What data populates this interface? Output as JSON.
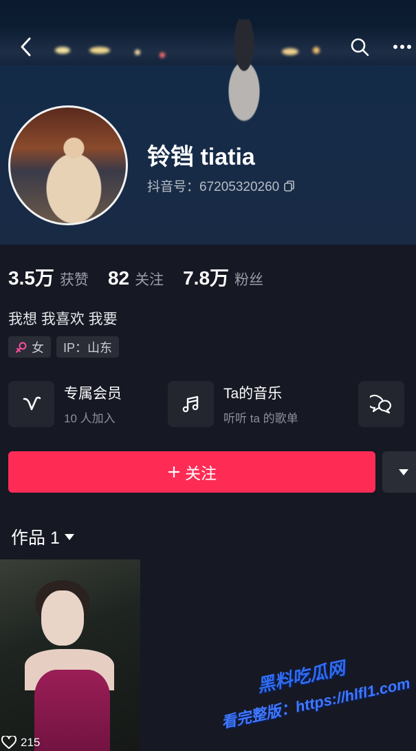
{
  "profile": {
    "name": "铃铛 tiatia",
    "douyin_id": "抖音号：67205320260",
    "bio": "我想 我喜欢 我要",
    "tags": {
      "gender": "女",
      "ip": "IP：山东"
    }
  },
  "stats": [
    {
      "value": "3.5万",
      "label": "获赞"
    },
    {
      "value": "82",
      "label": "关注"
    },
    {
      "value": "7.8万",
      "label": "粉丝"
    }
  ],
  "features": [
    {
      "title": "专属会员",
      "subtitle": "10 人加入",
      "icon": "v-badge-icon"
    },
    {
      "title": "Ta的音乐",
      "subtitle": "听听 ta 的歌单",
      "icon": "music-note-icon"
    },
    {
      "title": "",
      "subtitle": "",
      "icon": "chat-bubble-icon"
    }
  ],
  "actions": {
    "follow_label": "关注"
  },
  "works": {
    "tab_label": "作品 1",
    "items": [
      {
        "likes": "215"
      }
    ]
  },
  "watermark": {
    "line1": "黑料吃瓜网",
    "line2": "看完整版：https://hlfl1.com"
  },
  "colors": {
    "accent": "#fe2c55",
    "background": "#161823"
  }
}
